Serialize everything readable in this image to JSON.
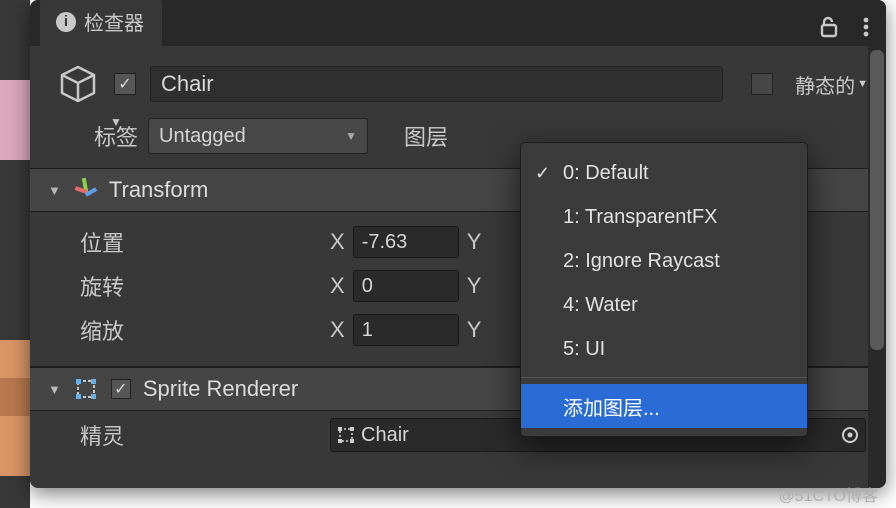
{
  "tab": {
    "title": "检查器"
  },
  "object": {
    "name": "Chair",
    "active": true,
    "static_label": "静态的",
    "tag_label": "标签",
    "tag_value": "Untagged",
    "layer_label": "图层"
  },
  "transform": {
    "title": "Transform",
    "position_label": "位置",
    "rotation_label": "旋转",
    "scale_label": "缩放",
    "x_label": "X",
    "y_label": "Y",
    "pos_x": "-7.63",
    "rot_x": "0",
    "scale_x": "1"
  },
  "sprite_renderer": {
    "title": "Sprite Renderer",
    "sprite_label": "精灵",
    "sprite_value": "Chair"
  },
  "layer_menu": {
    "items": [
      {
        "label": "0: Default",
        "selected": true
      },
      {
        "label": "1: TransparentFX",
        "selected": false
      },
      {
        "label": "2: Ignore Raycast",
        "selected": false
      },
      {
        "label": "4: Water",
        "selected": false
      },
      {
        "label": "5: UI",
        "selected": false
      }
    ],
    "add_label": "添加图层..."
  },
  "watermark": "@51CTO博客"
}
